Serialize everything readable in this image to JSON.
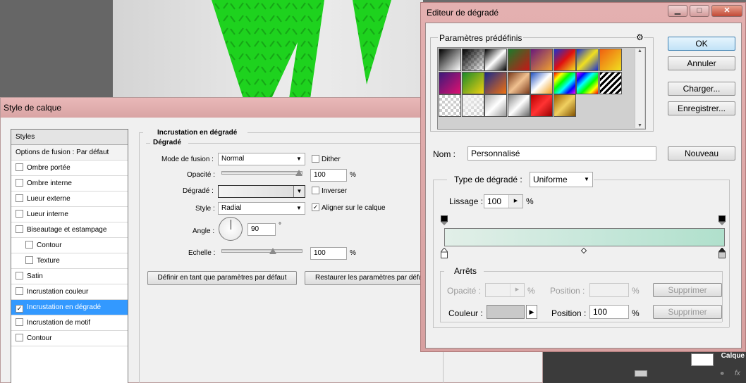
{
  "layer_style": {
    "title": "Style de calque",
    "styles_header": "Styles",
    "blend_options": "Options de fusion : Par défaut",
    "items": [
      {
        "label": "Ombre portée",
        "checked": false,
        "indent": false
      },
      {
        "label": "Ombre interne",
        "checked": false,
        "indent": false
      },
      {
        "label": "Lueur externe",
        "checked": false,
        "indent": false
      },
      {
        "label": "Lueur interne",
        "checked": false,
        "indent": false
      },
      {
        "label": "Biseautage et estampage",
        "checked": false,
        "indent": false
      },
      {
        "label": "Contour",
        "checked": false,
        "indent": true
      },
      {
        "label": "Texture",
        "checked": false,
        "indent": true
      },
      {
        "label": "Satin",
        "checked": false,
        "indent": false
      },
      {
        "label": "Incrustation couleur",
        "checked": false,
        "indent": false
      },
      {
        "label": "Incrustation en dégradé",
        "checked": true,
        "indent": false,
        "selected": true
      },
      {
        "label": "Incrustation de motif",
        "checked": false,
        "indent": false
      },
      {
        "label": "Contour",
        "checked": false,
        "indent": false
      }
    ],
    "section_title": "Incrustation en dégradé",
    "subsection_title": "Dégradé",
    "blend_mode_label": "Mode de fusion :",
    "blend_mode_value": "Normal",
    "dither_label": "Dither",
    "dither_checked": false,
    "opacity_label": "Opacité :",
    "opacity_value": "100",
    "opacity_unit": "%",
    "gradient_label": "Dégradé :",
    "reverse_label": "Inverser",
    "reverse_checked": false,
    "style_label": "Style :",
    "style_value": "Radial",
    "align_label": "Aligner sur le calque",
    "align_checked": true,
    "angle_label": "Angle :",
    "angle_value": "90",
    "angle_unit": "°",
    "scale_label": "Echelle :",
    "scale_value": "100",
    "scale_unit": "%",
    "btn_default": "Définir en tant que paramètres par défaut",
    "btn_restore": "Restaurer les paramètres par défaut"
  },
  "gradient_editor": {
    "title": "Editeur de dégradé",
    "presets_label": "Paramètres prédéfinis",
    "ok": "OK",
    "cancel": "Annuler",
    "load": "Charger...",
    "save": "Enregistrer...",
    "name_label": "Nom :",
    "name_value": "Personnalisé",
    "new_button": "Nouveau",
    "type_label": "Type de dégradé :",
    "type_value": "Uniforme",
    "smoothness_label": "Lissage :",
    "smoothness_value": "100",
    "smoothness_unit": "%",
    "stops_label": "Arrêts",
    "opacity_label": "Opacité :",
    "opacity_unit": "%",
    "position_label": "Position :",
    "position_unit": "%",
    "delete_label": "Supprimer",
    "color_label": "Couleur :",
    "color_position_label": "Position :",
    "color_position_value": "100",
    "color_position_unit": "%",
    "delete_label_2": "Supprimer"
  },
  "layers_panel": {
    "layer_label": "Calque"
  },
  "colors": {
    "accent_selected": "#3399ff",
    "titlebar_pink": "#e4b0b0",
    "gradient_start": "#e2efe8",
    "gradient_end": "#b0e0cc",
    "letter_green": "#1fd41f"
  }
}
